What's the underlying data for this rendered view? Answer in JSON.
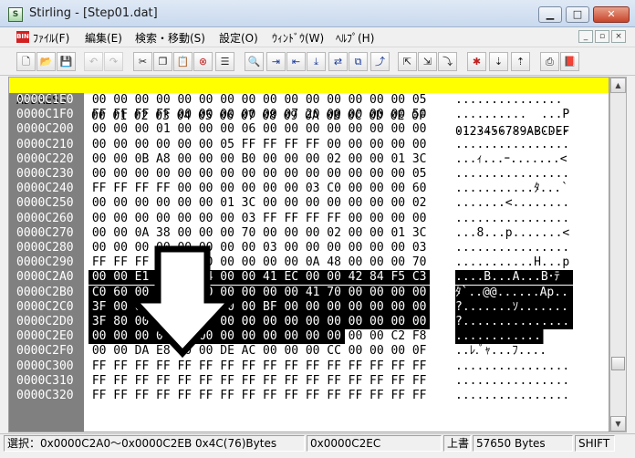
{
  "window": {
    "app_icon": "app-icon",
    "title": "Stirling - [Step01.dat]",
    "minimize": "▁",
    "maximize": "□",
    "close": "✕"
  },
  "menu": {
    "icon": "BIN",
    "items": [
      "ﾌｧｲﾙ(F)",
      "編集(E)",
      "検索・移動(S)",
      "設定(O)",
      "ｳｨﾝﾄﾞｳ(W)",
      "ﾍﾙﾌﾟ(H)"
    ],
    "mdi": [
      "_",
      "▫",
      "×"
    ]
  },
  "toolbar": {
    "buttons": [
      {
        "name": "new-icon",
        "glyph": "🗋"
      },
      {
        "name": "open-icon",
        "glyph": "📂"
      },
      {
        "name": "save-icon",
        "glyph": "💾"
      },
      {
        "name": "undo-icon",
        "glyph": "↶"
      },
      {
        "name": "redo-icon",
        "glyph": "↷"
      },
      {
        "name": "cut-icon",
        "glyph": "✂"
      },
      {
        "name": "copy-icon",
        "glyph": "❐"
      },
      {
        "name": "paste-icon",
        "glyph": "📋"
      },
      {
        "name": "delete-icon",
        "glyph": "⊗"
      },
      {
        "name": "insert-icon",
        "glyph": "☰"
      },
      {
        "name": "find-icon",
        "glyph": "🔍"
      },
      {
        "name": "find-next-icon",
        "glyph": "⇥"
      },
      {
        "name": "find-prev-icon",
        "glyph": "⇤"
      },
      {
        "name": "find-down-icon",
        "glyph": "⤓"
      },
      {
        "name": "replace-icon",
        "glyph": "⇄"
      },
      {
        "name": "compare-icon",
        "glyph": "⧉"
      },
      {
        "name": "jump-icon",
        "glyph": "⤴"
      },
      {
        "name": "page-top-icon",
        "glyph": "⇱"
      },
      {
        "name": "page-bottom-icon",
        "glyph": "⇲"
      },
      {
        "name": "page-jump-icon",
        "glyph": "⤵"
      },
      {
        "name": "mark-icon",
        "glyph": "✱"
      },
      {
        "name": "mark-next-icon",
        "glyph": "⇣"
      },
      {
        "name": "mark-prev-icon",
        "glyph": "⇡"
      },
      {
        "name": "print-icon",
        "glyph": "⎙"
      },
      {
        "name": "book-icon",
        "glyph": "📕"
      }
    ]
  },
  "colors": {
    "header_bg": "#ffff00",
    "gutter_bg": "#808080",
    "selection_bg": "#000000"
  },
  "header": {
    "address": "ADDRESS",
    "columns": [
      "00",
      "01",
      "02",
      "03",
      "04",
      "05",
      "06",
      "07",
      "08",
      "09",
      "0A",
      "0B",
      "0C",
      "0D",
      "0E",
      "0F"
    ],
    "ascii": "0123456789ABCDEF"
  },
  "rows": [
    {
      "addr": "0000C1E0",
      "bytes": [
        "00",
        "00",
        "00",
        "00",
        "00",
        "00",
        "00",
        "00",
        "00",
        "00",
        "00",
        "00",
        "00",
        "00",
        "00",
        "05"
      ],
      "ascii": "...............",
      "sel": []
    },
    {
      "addr": "0000C1F0",
      "bytes": [
        "FF",
        "FF",
        "FF",
        "FF",
        "00",
        "00",
        "00",
        "00",
        "00",
        "07",
        "20",
        "00",
        "00",
        "00",
        "00",
        "50"
      ],
      "ascii": "..........  ...P",
      "sel": []
    },
    {
      "addr": "0000C200",
      "bytes": [
        "00",
        "00",
        "00",
        "01",
        "00",
        "00",
        "00",
        "06",
        "00",
        "00",
        "00",
        "00",
        "00",
        "00",
        "00",
        "00"
      ],
      "ascii": "................",
      "sel": []
    },
    {
      "addr": "0000C210",
      "bytes": [
        "00",
        "00",
        "00",
        "00",
        "00",
        "00",
        "05",
        "FF",
        "FF",
        "FF",
        "FF",
        "00",
        "00",
        "00",
        "00",
        "00"
      ],
      "ascii": "................",
      "sel": []
    },
    {
      "addr": "0000C220",
      "bytes": [
        "00",
        "00",
        "0B",
        "A8",
        "00",
        "00",
        "00",
        "B0",
        "00",
        "00",
        "00",
        "02",
        "00",
        "00",
        "01",
        "3C"
      ],
      "ascii": "...ｨ...ｰ.......<",
      "sel": []
    },
    {
      "addr": "0000C230",
      "bytes": [
        "00",
        "00",
        "00",
        "00",
        "00",
        "00",
        "00",
        "00",
        "00",
        "00",
        "00",
        "00",
        "00",
        "00",
        "00",
        "05"
      ],
      "ascii": "................",
      "sel": []
    },
    {
      "addr": "0000C240",
      "bytes": [
        "FF",
        "FF",
        "FF",
        "FF",
        "00",
        "00",
        "00",
        "00",
        "00",
        "00",
        "03",
        "C0",
        "00",
        "00",
        "00",
        "60"
      ],
      "ascii": "...........ﾀ...`",
      "sel": []
    },
    {
      "addr": "0000C250",
      "bytes": [
        "00",
        "00",
        "00",
        "00",
        "00",
        "00",
        "01",
        "3C",
        "00",
        "00",
        "00",
        "00",
        "00",
        "00",
        "00",
        "02"
      ],
      "ascii": ".......<........",
      "sel": []
    },
    {
      "addr": "0000C260",
      "bytes": [
        "00",
        "00",
        "00",
        "00",
        "00",
        "00",
        "00",
        "03",
        "FF",
        "FF",
        "FF",
        "FF",
        "00",
        "00",
        "00",
        "00"
      ],
      "ascii": "................",
      "sel": []
    },
    {
      "addr": "0000C270",
      "bytes": [
        "00",
        "00",
        "0A",
        "38",
        "00",
        "00",
        "00",
        "70",
        "00",
        "00",
        "00",
        "02",
        "00",
        "00",
        "01",
        "3C"
      ],
      "ascii": "...8...p.......<",
      "sel": []
    },
    {
      "addr": "0000C280",
      "bytes": [
        "00",
        "00",
        "00",
        "00",
        "00",
        "00",
        "00",
        "00",
        "03",
        "00",
        "00",
        "00",
        "00",
        "00",
        "00",
        "03"
      ],
      "ascii": "................",
      "sel": []
    },
    {
      "addr": "0000C290",
      "bytes": [
        "FF",
        "FF",
        "FF",
        "FF",
        "00",
        "00",
        "00",
        "00",
        "00",
        "00",
        "0A",
        "48",
        "00",
        "00",
        "00",
        "70"
      ],
      "ascii": "...........H...p",
      "sel": []
    },
    {
      "addr": "0000C2A0",
      "bytes": [
        "00",
        "00",
        "E1",
        "1C",
        "42",
        "04",
        "00",
        "00",
        "41",
        "EC",
        "00",
        "00",
        "42",
        "84",
        "F5",
        "C3"
      ],
      "ascii": "....B...A...B･ﾃ",
      "sel": [
        0,
        1,
        2,
        3,
        4,
        5,
        6,
        7,
        8,
        9,
        10,
        11,
        12,
        13,
        14,
        15
      ],
      "ascii_sel": true
    },
    {
      "addr": "0000C2B0",
      "bytes": [
        "C0",
        "60",
        "00",
        "00",
        "40",
        "40",
        "00",
        "00",
        "00",
        "00",
        "41",
        "70",
        "00",
        "00",
        "00",
        "00"
      ],
      "ascii": "ﾀ`..@@......Ap..",
      "sel": [
        0,
        1,
        2,
        3,
        4,
        5,
        6,
        7,
        8,
        9,
        10,
        11,
        12,
        13,
        14,
        15
      ],
      "ascii_sel": true
    },
    {
      "addr": "0000C2C0",
      "bytes": [
        "3F",
        "00",
        "00",
        "00",
        "00",
        "00",
        "00",
        "00",
        "BF",
        "00",
        "00",
        "00",
        "00",
        "00",
        "00",
        "00"
      ],
      "ascii": "?.......ｿ.......",
      "sel": [
        0,
        1,
        2,
        3,
        4,
        5,
        6,
        7,
        8,
        9,
        10,
        11,
        12,
        13,
        14,
        15
      ],
      "ascii_sel": true
    },
    {
      "addr": "0000C2D0",
      "bytes": [
        "3F",
        "80",
        "00",
        "00",
        "00",
        "00",
        "00",
        "00",
        "00",
        "00",
        "00",
        "00",
        "00",
        "00",
        "00",
        "00"
      ],
      "ascii": "?...............",
      "sel": [
        0,
        1,
        2,
        3,
        4,
        5,
        6,
        7,
        8,
        9,
        10,
        11,
        12,
        13,
        14,
        15
      ],
      "ascii_sel": true
    },
    {
      "addr": "0000C2E0",
      "bytes": [
        "00",
        "00",
        "00",
        "00",
        "00",
        "00",
        "00",
        "00",
        "00",
        "00",
        "00",
        "00",
        "00",
        "00",
        "C2",
        "F8"
      ],
      "ascii": "..............ﾂ.",
      "sel": [
        0,
        1,
        2,
        3,
        4,
        5,
        6,
        7,
        8,
        9,
        10,
        11
      ],
      "ascii_sel": "partial"
    },
    {
      "addr": "0000C2F0",
      "bytes": [
        "00",
        "00",
        "DA",
        "E8",
        "00",
        "00",
        "DE",
        "AC",
        "00",
        "00",
        "00",
        "CC",
        "00",
        "00",
        "00",
        "0F"
      ],
      "ascii": "..ﾚ.ﾞｬ...ﾌ....",
      "sel": []
    },
    {
      "addr": "0000C300",
      "bytes": [
        "FF",
        "FF",
        "FF",
        "FF",
        "FF",
        "FF",
        "FF",
        "FF",
        "FF",
        "FF",
        "FF",
        "FF",
        "FF",
        "FF",
        "FF",
        "FF"
      ],
      "ascii": "................",
      "sel": []
    },
    {
      "addr": "0000C310",
      "bytes": [
        "FF",
        "FF",
        "FF",
        "FF",
        "FF",
        "FF",
        "FF",
        "FF",
        "FF",
        "FF",
        "FF",
        "FF",
        "FF",
        "FF",
        "FF",
        "FF"
      ],
      "ascii": "................",
      "sel": []
    },
    {
      "addr": "0000C320",
      "bytes": [
        "FF",
        "FF",
        "FF",
        "FF",
        "FF",
        "FF",
        "FF",
        "FF",
        "FF",
        "FF",
        "FF",
        "FF",
        "FF",
        "FF",
        "FF",
        "FF"
      ],
      "ascii": "................",
      "sel": []
    }
  ],
  "scrollbar": {
    "up": "▲",
    "down": "▼"
  },
  "status": {
    "selection": "選択：0x0000C2A0～0x0000C2EB  0x4C(76)Bytes",
    "cursor": "0x0000C2EC",
    "mode": "上書",
    "size": "57650 Bytes",
    "encoding": "SHIFT"
  }
}
